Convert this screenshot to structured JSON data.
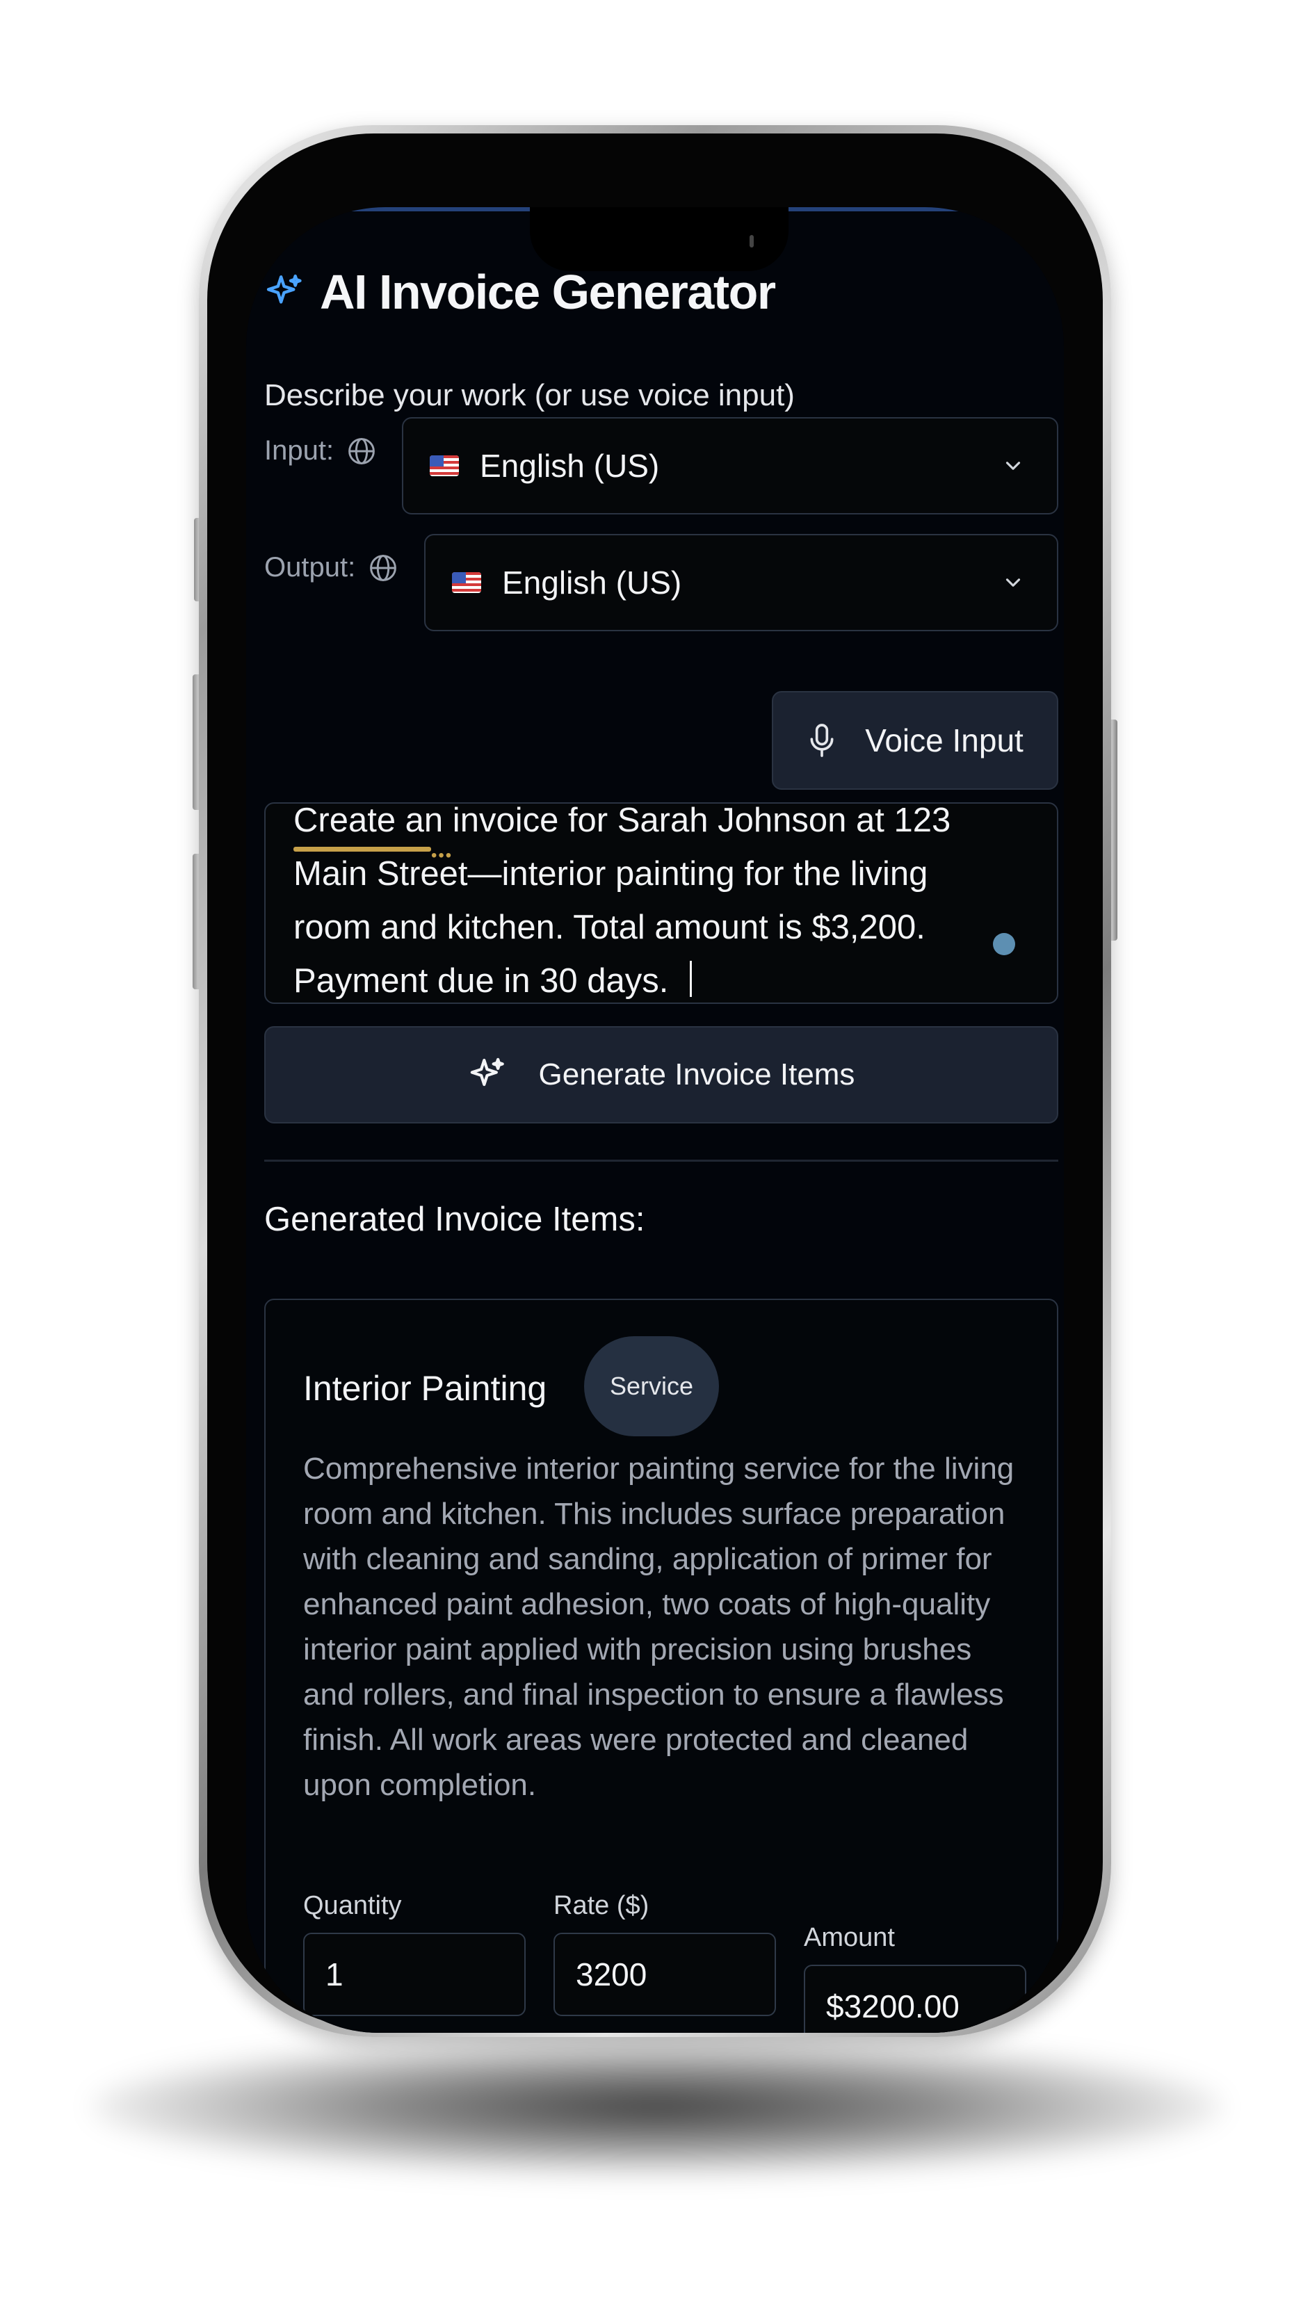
{
  "app": {
    "title": "AI Invoice Generator",
    "describe_label": "Describe your work (or use voice input)"
  },
  "language": {
    "input_label": "Input:",
    "output_label": "Output:",
    "input_value": "English (US)",
    "output_value": "English (US)"
  },
  "voice_button": {
    "label": "Voice Input"
  },
  "prompt_text": "Create an invoice for Sarah Johnson at 123\nMain Street—interior painting for the living\nroom and kitchen. Total amount is $3,200.\nPayment due in 30 days.",
  "generate_button": {
    "label": "Generate Invoice Items"
  },
  "generated": {
    "section_title": "Generated Invoice Items:",
    "items": [
      {
        "title": "Interior Painting",
        "badge": "Service",
        "description": "Comprehensive interior painting service for the living room and kitchen. This includes surface preparation with cleaning and sanding, application of primer for enhanced paint adhesion, two coats of high-quality interior paint applied with precision using brushes and rollers, and final inspection to ensure a flawless finish. All work areas were protected and cleaned upon completion.",
        "quantity_label": "Quantity",
        "quantity": "1",
        "rate_label": "Rate ($)",
        "rate": "3200",
        "amount_label": "Amount",
        "amount": "$3200.00"
      }
    ]
  },
  "colors": {
    "background": "#02050b",
    "accent_blue": "#4aa3ff",
    "button_bg": "#1b2230",
    "border": "#2a3342",
    "spellcheck_underline": "#c7a14a"
  },
  "icons": {
    "title": "sparkle-icon",
    "language": "globe-icon",
    "dropdown": "chevron-down-icon",
    "voice": "microphone-icon",
    "generate": "sparkle-icon",
    "flag": "us-flag-icon"
  }
}
